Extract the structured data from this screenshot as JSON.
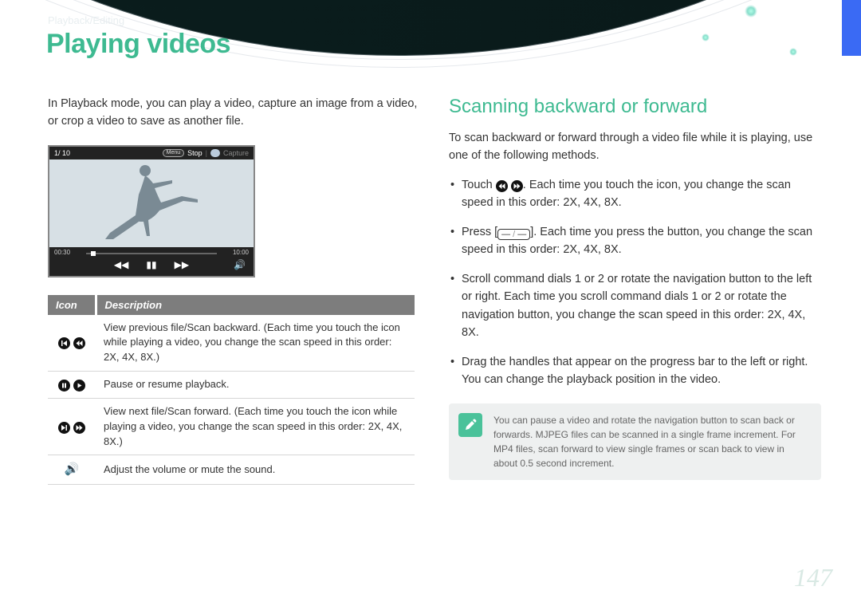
{
  "breadcrumb": "Playback/Editing",
  "title": "Playing videos",
  "page_number": "147",
  "left": {
    "intro": "In Playback mode, you can play a video, capture an image from a video, or crop a video to save as another file.",
    "video_preview": {
      "counter": "1/ 10",
      "menu_label": "Menu",
      "stop_label": "Stop",
      "capture_label": "Capture",
      "elapsed": "00:30",
      "total": "10:00"
    },
    "table": {
      "headers": {
        "icon": "Icon",
        "desc": "Description"
      },
      "rows": [
        {
          "icons": [
            "prev-file",
            "rewind"
          ],
          "desc": "View previous file/Scan backward. (Each time you touch the icon while playing a video, you change the scan speed in this order: 2X, 4X, 8X.)"
        },
        {
          "icons": [
            "pause",
            "play"
          ],
          "desc": "Pause or resume playback."
        },
        {
          "icons": [
            "next-file",
            "ffwd"
          ],
          "desc": "View next file/Scan forward. (Each time you touch the icon while playing a video, you change the scan speed in this order: 2X, 4X, 8X.)"
        },
        {
          "icons": [
            "volume"
          ],
          "desc": "Adjust the volume or mute the sound."
        }
      ]
    }
  },
  "right": {
    "heading": "Scanning backward or forward",
    "intro": "To scan backward or forward through a video file while it is playing, use one of the following methods.",
    "bullets": [
      {
        "prefix": "Touch ",
        "icons": [
          "rewind",
          "ffwd"
        ],
        "suffix": ". Each time you touch the icon, you change the scan speed in this order: 2X, 4X, 8X."
      },
      {
        "prefix": "Press [",
        "icons": [
          "minusplus"
        ],
        "suffix": "]. Each time you press the button, you change the scan speed in this order: 2X, 4X, 8X."
      },
      {
        "prefix": "",
        "icons": [],
        "suffix": "Scroll command dials 1 or 2 or rotate the navigation button to the left or right. Each time you scroll command dials 1 or 2 or rotate the navigation button, you change the scan speed in this order: 2X, 4X, 8X."
      },
      {
        "prefix": "",
        "icons": [],
        "suffix": "Drag the handles that appear on the progress bar to the left or right. You can change the playback position in the video."
      }
    ],
    "note": "You can pause a video and rotate the navigation button to scan back or forwards. MJPEG files can be scanned in a single frame increment. For MP4 files, scan forward to view single frames or scan back to view in about 0.5 second increment."
  }
}
